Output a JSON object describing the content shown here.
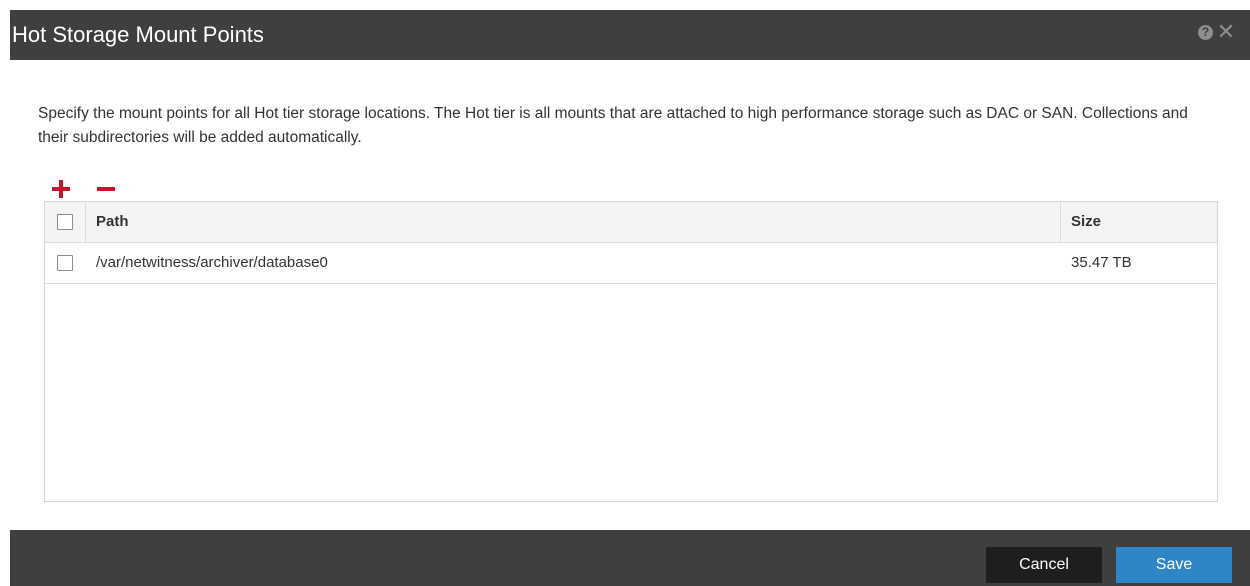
{
  "dialog": {
    "title": "Hot Storage Mount Points",
    "help_glyph": "?",
    "close_glyph": "✕"
  },
  "description": "Specify the mount points for all Hot tier storage locations. The Hot tier is all mounts that are attached to high performance storage such as DAC or SAN. Collections and their subdirectories will be added automatically.",
  "toolbar": {
    "add_icon": "plus-icon",
    "remove_icon": "minus-icon",
    "accent": "#c8142a"
  },
  "table": {
    "columns": [
      "Path",
      "Size"
    ],
    "rows": [
      {
        "path": "/var/netwitness/archiver/database0",
        "size": "35.47 TB"
      }
    ]
  },
  "buttons": {
    "cancel": "Cancel",
    "save": "Save"
  },
  "colors": {
    "titlebar": "#3f3f40",
    "save_button": "#2f86c6",
    "cancel_button": "#1e1e1e"
  }
}
